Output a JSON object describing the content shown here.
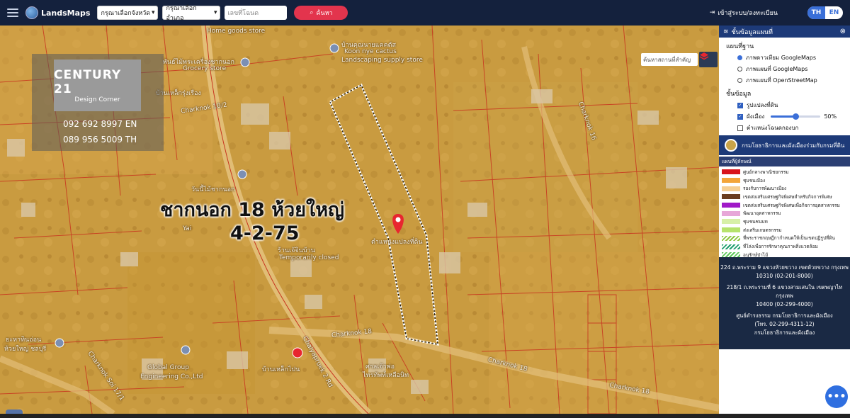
{
  "header": {
    "app_name": "LandsMaps",
    "province_select": "กรุณาเลือกจังหวัด",
    "amphoe_select": "กรุณาเลือกอำเภอ",
    "parcel_placeholder": "เลขที่โฉนด",
    "search_button": "ค้นหา",
    "login_link": "เข้าสู่ระบบ/ลงทะเบียน",
    "lang_th": "TH",
    "lang_en": "EN"
  },
  "agent_card": {
    "brand": "CENTURY 21",
    "branch": "Design Corner",
    "phone_en": "092 692 8997 EN",
    "phone_th": "089 956 5009 TH"
  },
  "map": {
    "title": "ชากนอก 18 ห้วยใหญ่",
    "area": "4-2-75",
    "search_place_placeholder": "ค้นหาสถานที่สำคัญ",
    "labels": [
      "Home goods store",
      "บ้านคุณนายแคคตัส",
      "Koon nye cactus",
      "Landscaping supply store",
      "พันธ์ไม้พระเครื่องชากนอก",
      "Grocery store",
      "บ้านเหล็กรุ่งเรือง",
      "Charknok 10/2",
      "Charknok 16",
      "วันนี้ไม้ชากนอก",
      "Yai",
      "ร้านเจ้จินบ้าน",
      "Temporarily closed",
      "ตำแหน่งแปลงที่ดิน",
      "Charknok 18",
      "Chaiyapruek 2 Rd",
      "Global Group",
      "Engineering Co.,Ltd",
      "บ้านเหล็กไปน",
      "ศาลเจ้าพ่อ",
      "ไทรทัพท์เหลือนิท",
      "Charknok 18",
      "Charknok 18",
      "ยะหาทินอ่อน",
      "ห้วยใหญ่ ชลบุรี",
      "Charknok Soi 17/1"
    ]
  },
  "panel": {
    "title": "ชั้นข้อมูลแผนที่",
    "basemap_title": "แผนที่ฐาน",
    "basemaps": [
      {
        "label": "ภาพดาวเทียม GoogleMaps",
        "selected": true
      },
      {
        "label": "ภาพแผนที่ GoogleMaps",
        "selected": false
      },
      {
        "label": "ภาพแผนที่ OpenStreetMap",
        "selected": false
      }
    ],
    "layers_title": "ชั้นข้อมูล",
    "layers": [
      {
        "label": "รูปแปลงที่ดิน",
        "checked": true
      },
      {
        "label": "ผังเมือง",
        "checked": true,
        "opacity": "50%",
        "opacity_value": 0.5
      },
      {
        "label": "ตำแหน่งโฉนดกองบก",
        "checked": false
      }
    ],
    "department": "กรมโยธาธิการและผังเมืองร่วมกับกรมที่ดิน",
    "legend_title": "แผนที่ผู้ลักษณ์",
    "legend": [
      {
        "color": "#d8141c",
        "label": "ศูนย์กลางพาณิชยกรรม"
      },
      {
        "color": "#f3a53a",
        "label": "ชุมชนเมือง"
      },
      {
        "color": "#f6cf93",
        "label": "รองรับการพัฒนาเมือง"
      },
      {
        "color": "#6b3d1f",
        "label": "เขตส่งเสริมเศรษฐกิจพิเศษสำหรับกิจการพิเศษ"
      },
      {
        "color": "#a019c8",
        "label": "เขตส่งเสริมเศรษฐกิจพิเศษเพื่อกิจการอุตสาหกรรม"
      },
      {
        "color": "#e7a7d8",
        "label": "พัฒนาอุตสาหกรรม"
      },
      {
        "color": "#d7f0a8",
        "label": "ชุมชนชนบท"
      },
      {
        "color": "#b6e36d",
        "label": "ส่งเสริมเกษตรกรรม"
      },
      {
        "color": "#8cc63f",
        "label": "ที่พระราชกฤษฎีกากำหนดให้เป็นเขตปฏิรูปที่ดิน"
      },
      {
        "color": "#1e9d6e",
        "label": "ที่โล่งเพื่อการรักษาคุณภาพสิ่งแวดล้อม"
      },
      {
        "color": "#5ec85a",
        "label": "อนุรักษ์ป่าไม้"
      }
    ],
    "address_lines": [
      "224 ถ.พระราม 9 แขวงห้วยขวาง เขตห้วยขวาง กรุงเทพ",
      "10310 (02-201-8000)",
      "218/1 ถ.พระรามที่ 6 แขวงสามเสนใน เขตพญาไท กรุงเทพ",
      "10400 (02-299-4000)",
      "ศูนย์ดำรงธรรม กรมโยธาธิการและผังเมือง",
      "(โทร. 02-299-4311-12)",
      "กรมโยธาธิการและผังเมือง"
    ]
  },
  "colors": {
    "topbar": "#14213d",
    "map_overlay": "#c79a3e",
    "search_button": "#e3344d",
    "panel_head": "#1d3a78",
    "pin": "#e8262f"
  }
}
